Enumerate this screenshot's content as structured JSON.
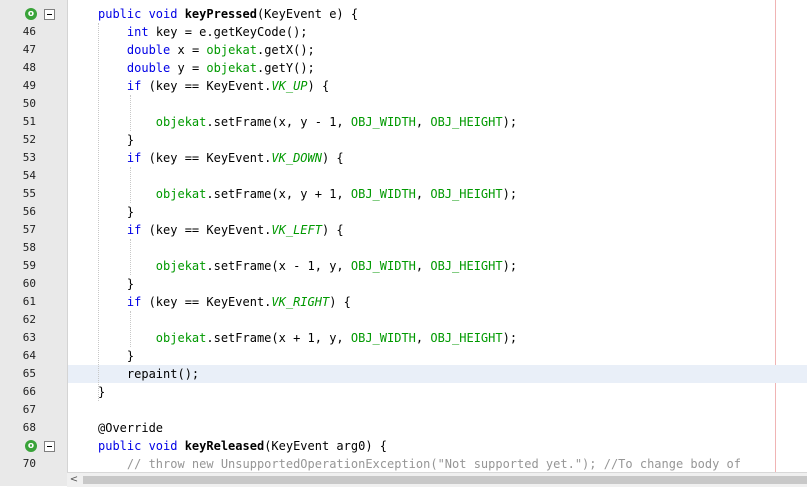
{
  "editor": {
    "lines": [
      {
        "num": "",
        "tokens": [
          {
            "t": "public void ",
            "c": "kw"
          },
          {
            "t": "keyPressed",
            "c": "fn"
          },
          {
            "t": "(KeyEvent e) {",
            "c": ""
          }
        ]
      },
      {
        "num": "46",
        "tokens": [
          {
            "t": "    ",
            "c": ""
          },
          {
            "t": "int",
            "c": "kw"
          },
          {
            "t": " key = e.getKeyCode();",
            "c": ""
          }
        ]
      },
      {
        "num": "47",
        "tokens": [
          {
            "t": "    ",
            "c": ""
          },
          {
            "t": "double",
            "c": "kw"
          },
          {
            "t": " x = ",
            "c": ""
          },
          {
            "t": "objekat",
            "c": "fld"
          },
          {
            "t": ".getX();",
            "c": ""
          }
        ]
      },
      {
        "num": "48",
        "tokens": [
          {
            "t": "    ",
            "c": ""
          },
          {
            "t": "double",
            "c": "kw"
          },
          {
            "t": " y = ",
            "c": ""
          },
          {
            "t": "objekat",
            "c": "fld"
          },
          {
            "t": ".getY();",
            "c": ""
          }
        ]
      },
      {
        "num": "49",
        "tokens": [
          {
            "t": "    ",
            "c": ""
          },
          {
            "t": "if",
            "c": "kw"
          },
          {
            "t": " (key == KeyEvent.",
            "c": ""
          },
          {
            "t": "VK_UP",
            "c": "const"
          },
          {
            "t": ") {",
            "c": ""
          }
        ]
      },
      {
        "num": "50",
        "tokens": []
      },
      {
        "num": "51",
        "tokens": [
          {
            "t": "        ",
            "c": ""
          },
          {
            "t": "objekat",
            "c": "fld"
          },
          {
            "t": ".setFrame(x, y - 1, ",
            "c": ""
          },
          {
            "t": "OBJ_WIDTH",
            "c": "fld"
          },
          {
            "t": ", ",
            "c": ""
          },
          {
            "t": "OBJ_HEIGHT",
            "c": "fld"
          },
          {
            "t": ");",
            "c": ""
          }
        ]
      },
      {
        "num": "52",
        "tokens": [
          {
            "t": "    }",
            "c": ""
          }
        ]
      },
      {
        "num": "53",
        "tokens": [
          {
            "t": "    ",
            "c": ""
          },
          {
            "t": "if",
            "c": "kw"
          },
          {
            "t": " (key == KeyEvent.",
            "c": ""
          },
          {
            "t": "VK_DOWN",
            "c": "const"
          },
          {
            "t": ") {",
            "c": ""
          }
        ]
      },
      {
        "num": "54",
        "tokens": []
      },
      {
        "num": "55",
        "tokens": [
          {
            "t": "        ",
            "c": ""
          },
          {
            "t": "objekat",
            "c": "fld"
          },
          {
            "t": ".setFrame(x, y + 1, ",
            "c": ""
          },
          {
            "t": "OBJ_WIDTH",
            "c": "fld"
          },
          {
            "t": ", ",
            "c": ""
          },
          {
            "t": "OBJ_HEIGHT",
            "c": "fld"
          },
          {
            "t": ");",
            "c": ""
          }
        ]
      },
      {
        "num": "56",
        "tokens": [
          {
            "t": "    }",
            "c": ""
          }
        ]
      },
      {
        "num": "57",
        "tokens": [
          {
            "t": "    ",
            "c": ""
          },
          {
            "t": "if",
            "c": "kw"
          },
          {
            "t": " (key == KeyEvent.",
            "c": ""
          },
          {
            "t": "VK_LEFT",
            "c": "const"
          },
          {
            "t": ") {",
            "c": ""
          }
        ]
      },
      {
        "num": "58",
        "tokens": []
      },
      {
        "num": "59",
        "tokens": [
          {
            "t": "        ",
            "c": ""
          },
          {
            "t": "objekat",
            "c": "fld"
          },
          {
            "t": ".setFrame(x - 1, y, ",
            "c": ""
          },
          {
            "t": "OBJ_WIDTH",
            "c": "fld"
          },
          {
            "t": ", ",
            "c": ""
          },
          {
            "t": "OBJ_HEIGHT",
            "c": "fld"
          },
          {
            "t": ");",
            "c": ""
          }
        ]
      },
      {
        "num": "60",
        "tokens": [
          {
            "t": "    }",
            "c": ""
          }
        ]
      },
      {
        "num": "61",
        "tokens": [
          {
            "t": "    ",
            "c": ""
          },
          {
            "t": "if",
            "c": "kw"
          },
          {
            "t": " (key == KeyEvent.",
            "c": ""
          },
          {
            "t": "VK_RIGHT",
            "c": "const"
          },
          {
            "t": ") {",
            "c": ""
          }
        ]
      },
      {
        "num": "62",
        "tokens": []
      },
      {
        "num": "63",
        "tokens": [
          {
            "t": "        ",
            "c": ""
          },
          {
            "t": "objekat",
            "c": "fld"
          },
          {
            "t": ".setFrame(x + 1, y, ",
            "c": ""
          },
          {
            "t": "OBJ_WIDTH",
            "c": "fld"
          },
          {
            "t": ", ",
            "c": ""
          },
          {
            "t": "OBJ_HEIGHT",
            "c": "fld"
          },
          {
            "t": ");",
            "c": ""
          }
        ]
      },
      {
        "num": "64",
        "tokens": [
          {
            "t": "    }",
            "c": ""
          }
        ]
      },
      {
        "num": "65",
        "current": true,
        "tokens": [
          {
            "t": "    repaint();",
            "c": ""
          }
        ]
      },
      {
        "num": "66",
        "tokens": [
          {
            "t": "}",
            "c": ""
          }
        ]
      },
      {
        "num": "67",
        "tokens": []
      },
      {
        "num": "68",
        "tokens": [
          {
            "t": "@Override",
            "c": "ann"
          }
        ]
      },
      {
        "num": "",
        "tokens": [
          {
            "t": "public void ",
            "c": "kw"
          },
          {
            "t": "keyReleased",
            "c": "fn"
          },
          {
            "t": "(KeyEvent arg0) {",
            "c": ""
          }
        ]
      },
      {
        "num": "70",
        "tokens": [
          {
            "t": "    ",
            "c": ""
          },
          {
            "t": "// throw new UnsupportedOperationException(\"Not supported yet.\"); //To change body of",
            "c": "cmt"
          }
        ]
      }
    ],
    "override_marks": [
      {
        "line": 0,
        "icon": "override-icon",
        "label": "o"
      },
      {
        "line": 24,
        "icon": "override-icon",
        "label": "o"
      }
    ],
    "fold_marks": [
      {
        "line": 0,
        "icon": "fold-collapse-icon"
      },
      {
        "line": 24,
        "icon": "fold-collapse-icon"
      }
    ]
  },
  "scrollbar": {
    "left_arrow": "<"
  },
  "colors": {
    "keyword": "#0000e6",
    "field": "#009900",
    "comment": "#969696",
    "current_line": "#e9eff8",
    "margin_line": "#f0b4b4"
  }
}
